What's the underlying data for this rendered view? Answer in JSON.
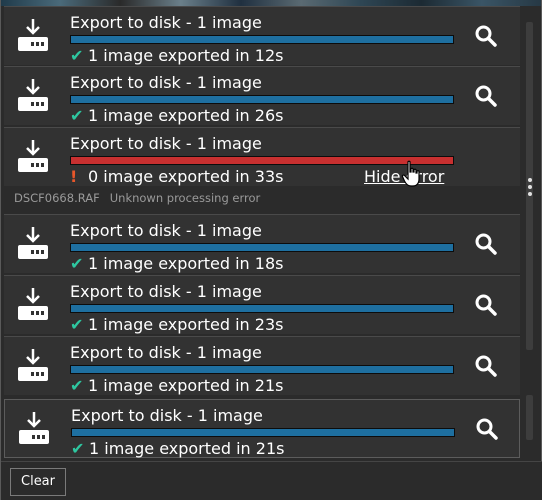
{
  "items": [
    {
      "title": "Export to disk - 1 image",
      "status": "1 image exported in 12s",
      "state": "success"
    },
    {
      "title": "Export to disk - 1 image",
      "status": "1 image exported in 26s",
      "state": "success"
    },
    {
      "title": "Export to disk - 1 image",
      "status": "0 image exported in 33s",
      "state": "error",
      "hide_error_label": "Hide error"
    },
    {
      "title": "Export to disk - 1 image",
      "status": "1 image exported in 18s",
      "state": "success"
    },
    {
      "title": "Export to disk - 1 image",
      "status": "1 image exported in 23s",
      "state": "success"
    },
    {
      "title": "Export to disk - 1 image",
      "status": "1 image exported in 21s",
      "state": "success"
    },
    {
      "title": "Export to disk - 1 image",
      "status": "1 image exported in 21s",
      "state": "success"
    }
  ],
  "error_detail": {
    "filename": "DSCF0668.RAF",
    "message": "Unknown processing error"
  },
  "footer": {
    "clear_label": "Clear"
  },
  "icons": {
    "success": "check-icon",
    "error": "exclamation-icon",
    "download": "download-to-disk-icon",
    "reveal": "search-icon"
  },
  "colors": {
    "progress": "#1e6fa0",
    "error_bar": "#c83030",
    "check": "#2ec7a0",
    "exclamation": "#e8572a",
    "background": "#2b2b2b"
  }
}
